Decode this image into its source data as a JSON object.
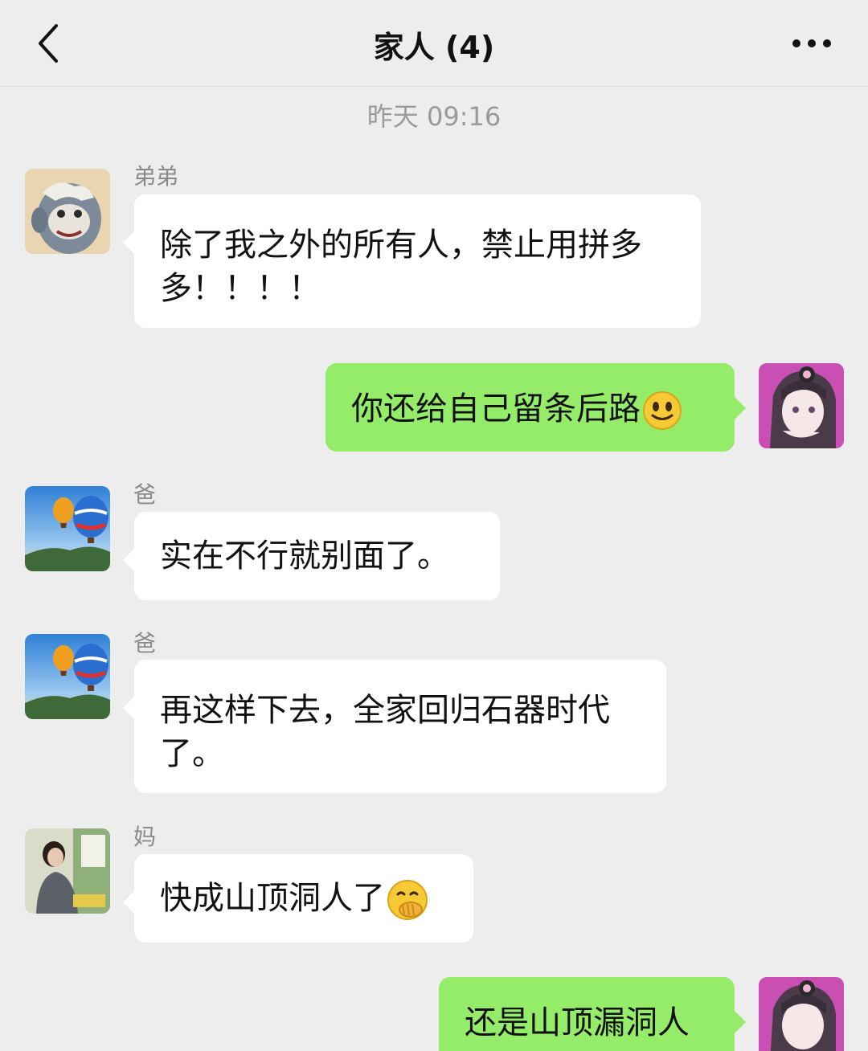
{
  "header": {
    "title": "家人 (4)"
  },
  "timestamp": "昨天 09:16",
  "messages": [
    {
      "sender": "弟弟",
      "text": "除了我之外的所有人，禁止用拼多多！！！！"
    },
    {
      "text": "你还给自己留条后路"
    },
    {
      "sender": "爸",
      "text": "实在不行就别面了。"
    },
    {
      "sender": "爸",
      "text": "再这样下去，全家回归石器时代了。"
    },
    {
      "sender": "妈",
      "text": "快成山顶洞人了"
    },
    {
      "text": "还是山顶漏洞人"
    }
  ],
  "icons": {
    "back": "chevron-left-icon",
    "more": "more-dots-icon",
    "emoji_smile": "smile-emoji",
    "emoji_hand_over_mouth": "hand-over-mouth-emoji"
  },
  "colors": {
    "background": "#ededed",
    "incoming_bubble": "#ffffff",
    "outgoing_bubble": "#95ec69"
  }
}
